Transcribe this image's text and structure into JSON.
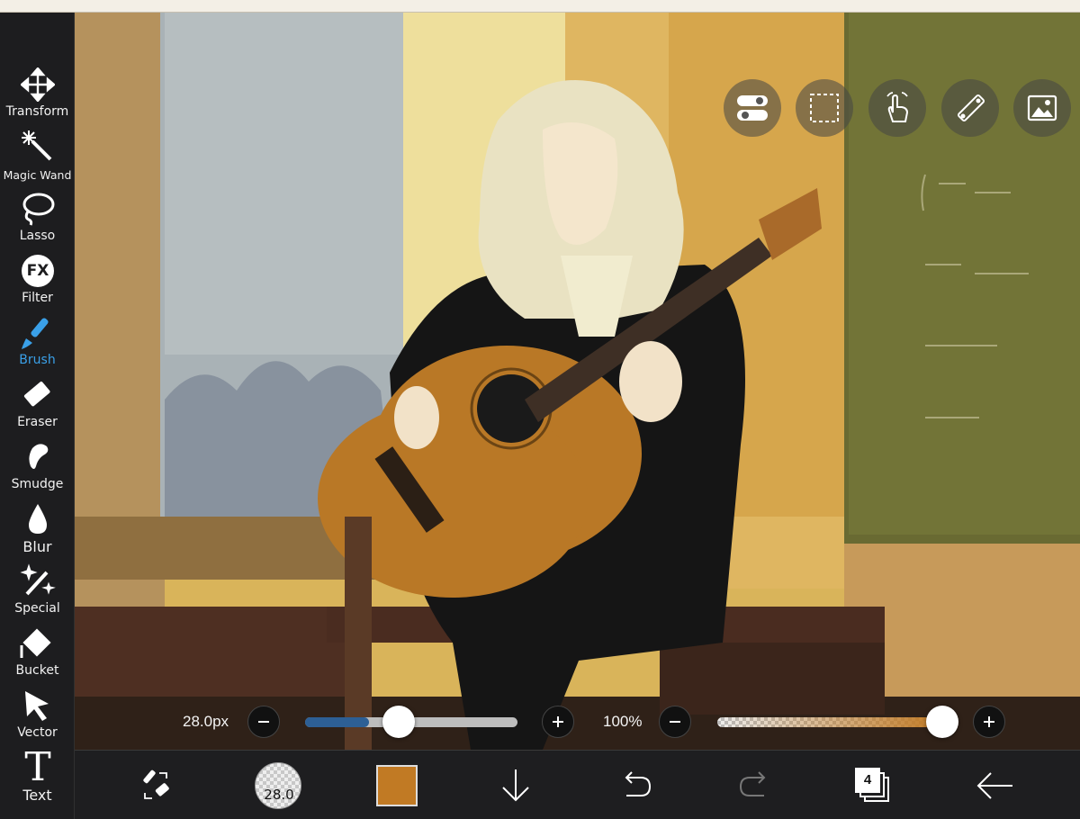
{
  "sidebar": {
    "tools": [
      {
        "label": "Transform",
        "icon": "move-arrows-icon"
      },
      {
        "label": "Magic Wand",
        "icon": "magic-wand-icon"
      },
      {
        "label": "Lasso",
        "icon": "lasso-icon"
      },
      {
        "label": "Filter",
        "icon": "fx-icon"
      },
      {
        "label": "Brush",
        "icon": "brush-icon"
      },
      {
        "label": "Eraser",
        "icon": "eraser-icon"
      },
      {
        "label": "Smudge",
        "icon": "smudge-finger-icon"
      },
      {
        "label": "Blur",
        "icon": "drop-icon"
      },
      {
        "label": "Special",
        "icon": "sparkle-wand-icon"
      },
      {
        "label": "Bucket",
        "icon": "bucket-icon"
      },
      {
        "label": "Vector",
        "icon": "cursor-arrow-icon"
      },
      {
        "label": "Text",
        "icon": "text-t-icon"
      }
    ],
    "fx_glyph": "FX",
    "text_glyph": "T",
    "active_tool": "Brush",
    "active_color": "#3aa0e8"
  },
  "canvas_buttons": [
    "toggle-icon",
    "selection-marquee-icon",
    "gesture-hand-icon",
    "ruler-icon",
    "image-reference-icon"
  ],
  "brush_size": {
    "label": "28.0px",
    "value": 28.0,
    "level": 0.3
  },
  "opacity": {
    "label": "100%",
    "value": 100,
    "level": 1.0
  },
  "bottombar": {
    "brush_preview_value": "28.0",
    "color_swatch": "#c17a24",
    "layer_count": "4"
  },
  "colors": {
    "ui_dark": "#1d1d1f",
    "slider_blue": "#2d5f95",
    "slider_track": "#bdbdbd",
    "paint_color": "#c17a24"
  }
}
